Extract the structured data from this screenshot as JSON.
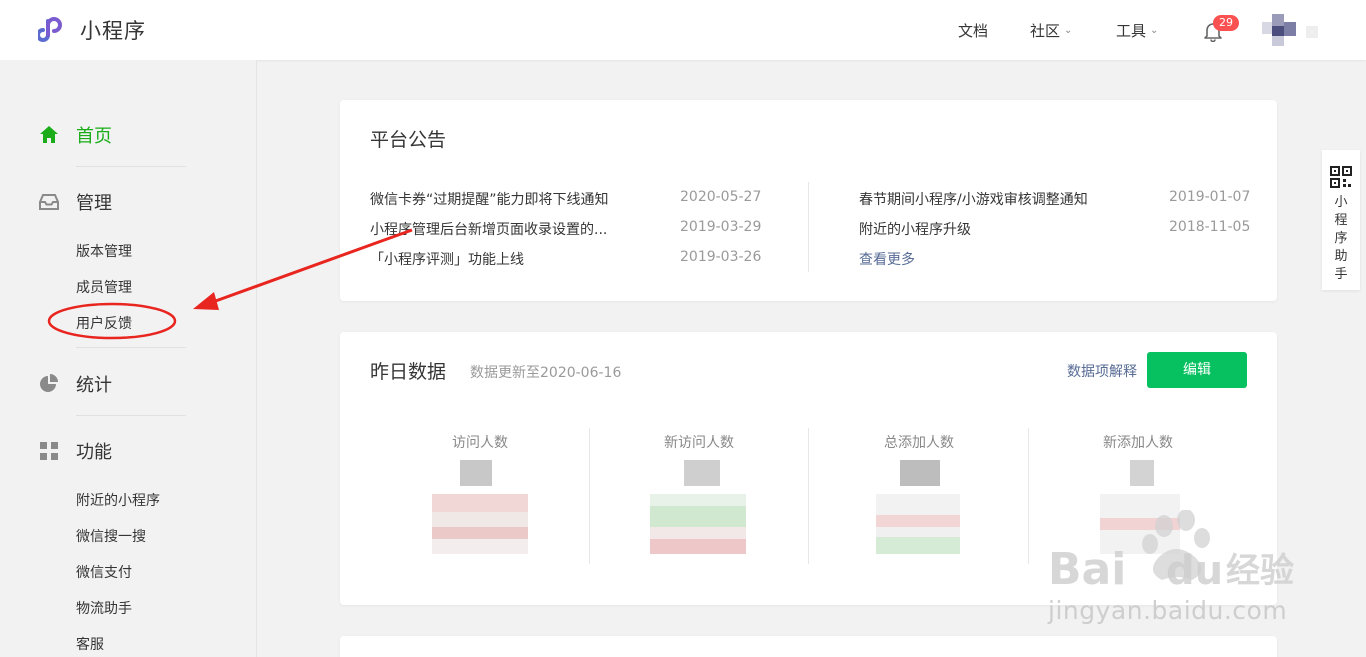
{
  "header": {
    "logo_text": "小程序",
    "nav": {
      "docs": "文档",
      "community": "社区",
      "tools": "工具"
    },
    "notification_count": "29"
  },
  "sidebar": {
    "home": "首页",
    "manage": "管理",
    "manage_items": [
      "版本管理",
      "成员管理",
      "用户反馈"
    ],
    "stats": "统计",
    "features": "功能",
    "feature_items": [
      "附近的小程序",
      "微信搜一搜",
      "微信支付",
      "物流助手",
      "客服"
    ]
  },
  "announcements": {
    "title": "平台公告",
    "left": [
      {
        "text": "微信卡券“过期提醒”能力即将下线通知",
        "date": "2020-05-27"
      },
      {
        "text": "小程序管理后台新增页面收录设置的...",
        "date": "2019-03-29"
      },
      {
        "text": "「小程序评测」功能上线",
        "date": "2019-03-26"
      }
    ],
    "right": [
      {
        "text": "春节期间小程序/小游戏审核调整通知",
        "date": "2019-01-07"
      },
      {
        "text": "附近的小程序升级",
        "date": "2018-11-05"
      }
    ],
    "more": "查看更多"
  },
  "yesterday": {
    "title": "昨日数据",
    "update_note": "数据更新至2020-06-16",
    "explain_link": "数据项解释",
    "edit_button": "编辑",
    "metrics": [
      "访问人数",
      "新访问人数",
      "总添加人数",
      "新添加人数"
    ]
  },
  "helper": {
    "label": "小程序助手"
  },
  "watermark": {
    "brand": "Baidu 经验",
    "url": "jingyan.baidu.com"
  },
  "colors": {
    "accent_green": "#1aad19",
    "button_green": "#07c160",
    "link_blue": "#576b95",
    "badge_red": "#fa5151",
    "annotation_red": "#e8261f"
  }
}
